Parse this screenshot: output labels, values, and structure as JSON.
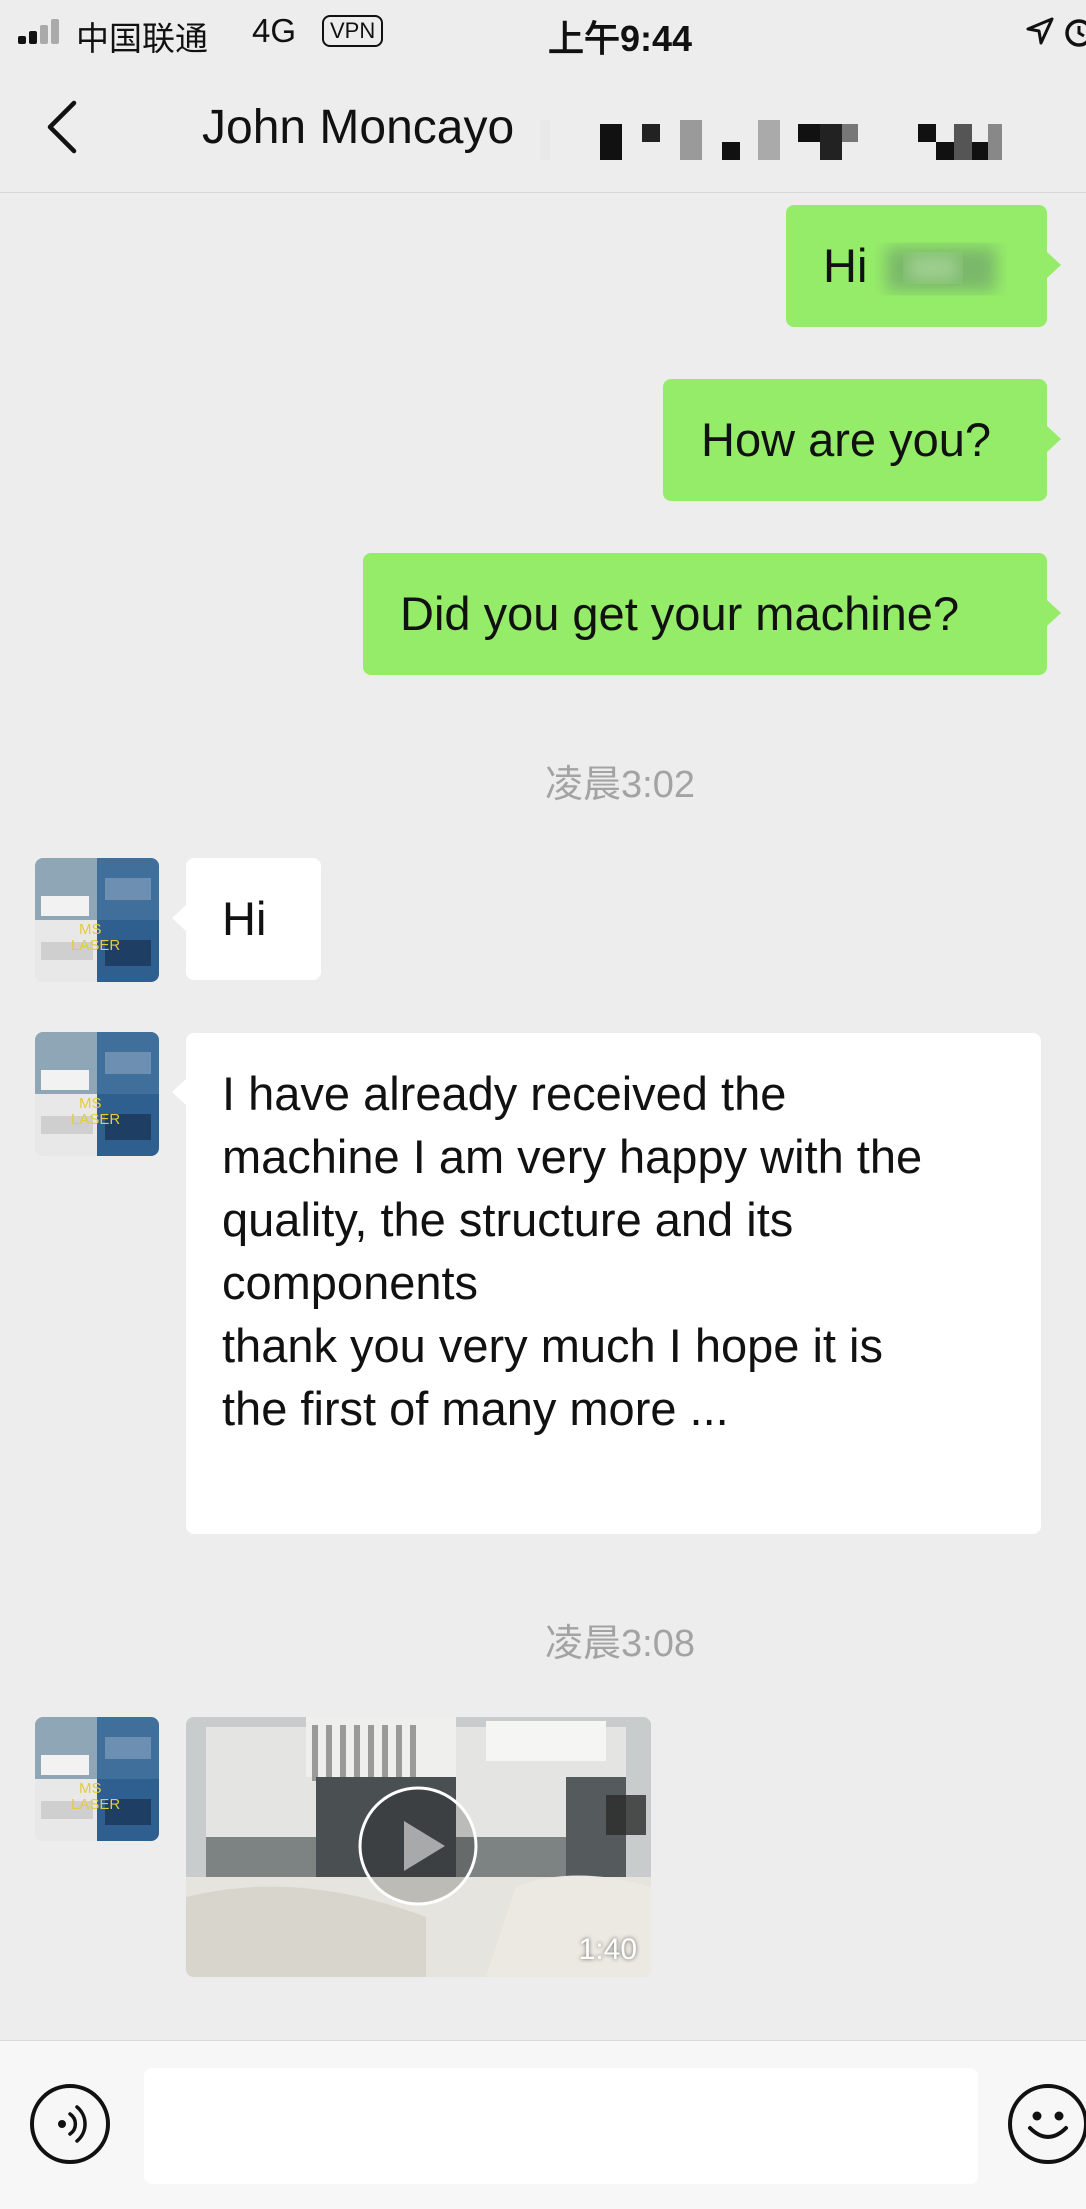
{
  "status_bar": {
    "carrier": "中国联通",
    "network": "4G",
    "vpn": "VPN",
    "time": "上午9:44"
  },
  "header": {
    "title": "John Moncayo"
  },
  "messages": {
    "m1": "Hi",
    "m2": "How are you?",
    "m3": "Did you get your machine?",
    "ts1": "凌晨3:02",
    "m4": "Hi",
    "m5_lines": [
      "I have already received the",
      "machine I am very happy with the",
      "quality, the structure and its",
      "components",
      "thank you very much I hope it is",
      "the first of many more ..."
    ],
    "ts2": "凌晨3:08",
    "video_duration": "1:40"
  },
  "avatar_text": "MS LASER",
  "colors": {
    "outgoing_bubble": "#95ec69",
    "incoming_bubble": "#ffffff",
    "background": "#ededed"
  },
  "icons": [
    "signal-icon",
    "location-arrow-icon",
    "alarm-icon",
    "back-chevron-icon",
    "voice-icon",
    "emoji-icon",
    "play-icon"
  ]
}
